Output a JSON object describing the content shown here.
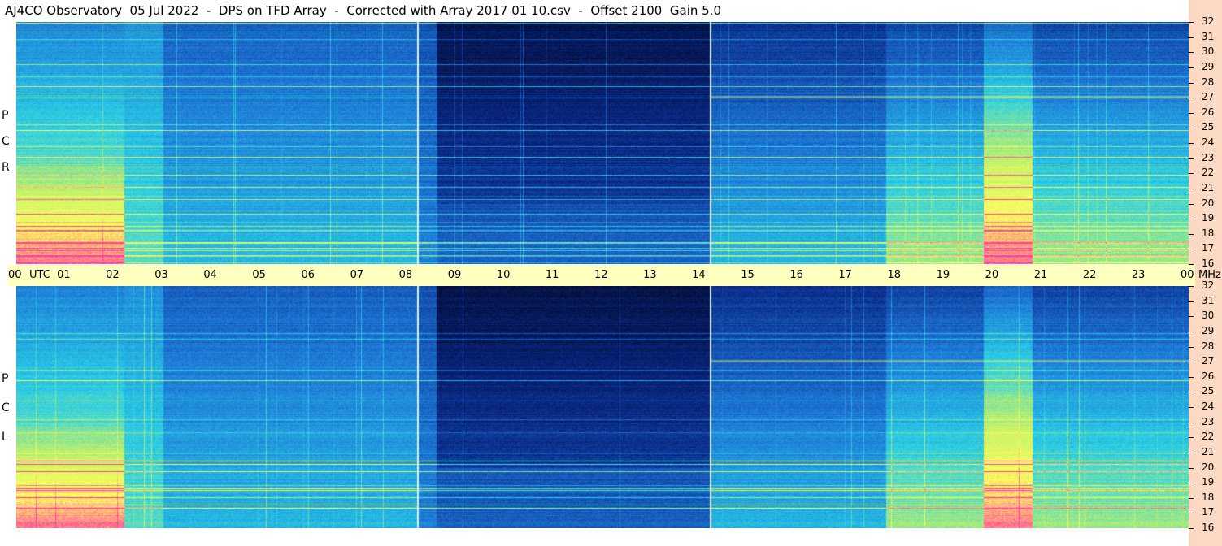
{
  "header": {
    "title": "AJ4CO Observatory  05 Jul 2022  -  DPS on TFD Array  -  Corrected with Array 2017 01 10.csv  -  Offset 2100  Gain 5.0"
  },
  "labels": {
    "top_polarization": [
      "R",
      "C",
      "P"
    ],
    "bottom_polarization": [
      "L",
      "C",
      "P"
    ]
  },
  "chart_data": {
    "type": "heatmap",
    "title": "AJ4CO Observatory  05 Jul 2022  -  DPS on TFD Array  -  Corrected with Array 2017 01 10.csv  -  Offset 2100  Gain 5.0",
    "x_unit": "UTC",
    "y_unit": "MHz",
    "x_range_hours": [
      0,
      24
    ],
    "y_range_mhz": [
      16,
      32
    ],
    "x_tick_labels": [
      "00",
      "UTC",
      "01",
      "02",
      "03",
      "04",
      "05",
      "06",
      "07",
      "08",
      "09",
      "10",
      "11",
      "12",
      "13",
      "14",
      "15",
      "16",
      "17",
      "18",
      "19",
      "20",
      "21",
      "22",
      "23",
      "00",
      "MHz"
    ],
    "y_tick_labels": [
      "32",
      "31",
      "30",
      "29",
      "28",
      "27",
      "26",
      "25",
      "24",
      "23",
      "22",
      "21",
      "20",
      "19",
      "18",
      "17",
      "16"
    ],
    "panels": [
      {
        "name": "RCP",
        "colormap": [
          "#000010",
          "#0a2a8a",
          "#1e7ad8",
          "#2ad0e6",
          "#bff06a",
          "#ffff60",
          "#ff40a0"
        ]
      },
      {
        "name": "LCP",
        "colormap": [
          "#000010",
          "#0a2a8a",
          "#1e7ad8",
          "#2ad0e6",
          "#bff06a",
          "#ffff60",
          "#ff40a0"
        ]
      }
    ],
    "vertical_markers_utc": [
      8.2,
      14.2
    ]
  }
}
